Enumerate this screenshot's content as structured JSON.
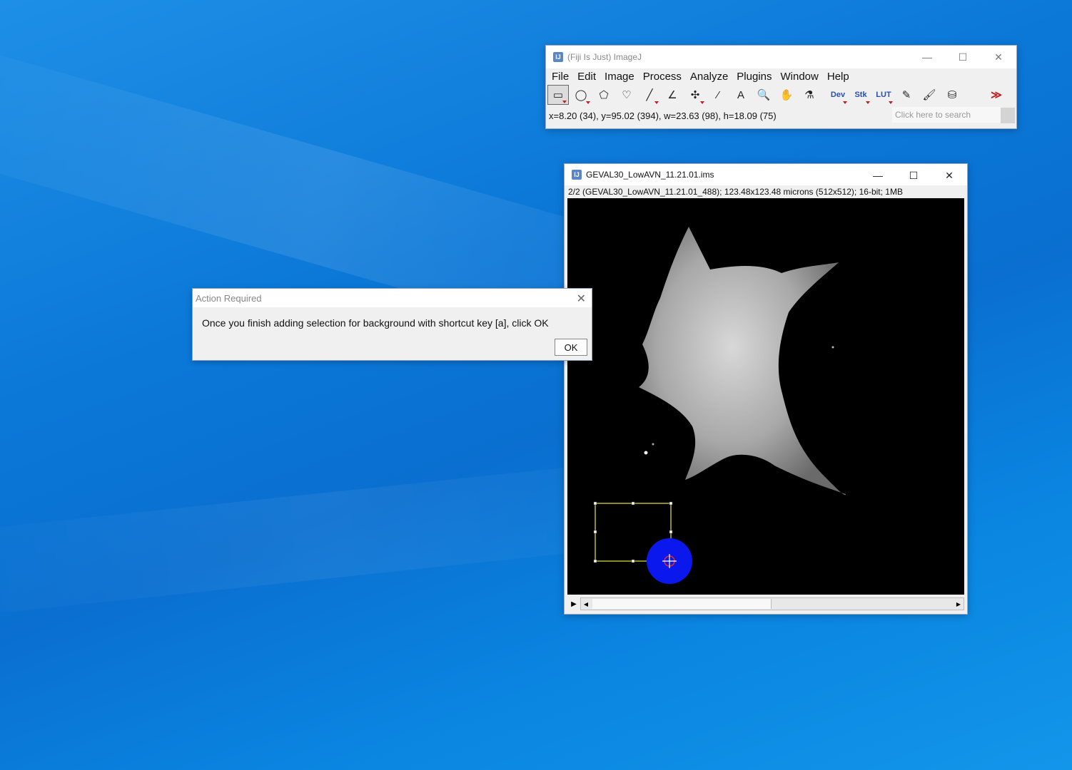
{
  "imagej": {
    "title": "(Fiji Is Just) ImageJ",
    "menus": [
      "File",
      "Edit",
      "Image",
      "Process",
      "Analyze",
      "Plugins",
      "Window",
      "Help"
    ],
    "tools": {
      "rect": "▭",
      "oval": "◯",
      "polygon": "⬠",
      "freehand": "♡",
      "line": "╱",
      "angle": "∠",
      "point": "✣",
      "wand": "⁄",
      "text": "A",
      "zoom": "🔍",
      "hand": "✋",
      "dropper": "⚗",
      "dev": "Dev",
      "stk": "Stk",
      "lut": "LUT",
      "pencil": "✎",
      "brush": "🖌",
      "fill": "⛁",
      "more": "≫"
    },
    "status": "x=8.20 (34), y=95.02 (394), w=23.63 (98), h=18.09 (75)",
    "search_placeholder": "Click here to search",
    "icon_letters": "IJ",
    "win_min": "—",
    "win_max": "☐",
    "win_close": "✕"
  },
  "image_window": {
    "title": "GEVAL30_LowAVN_11.21.01.ims",
    "info": "2/2 (GEVAL30_LowAVN_11.21.01_488); 123.48x123.48 microns (512x512); 16-bit; 1MB",
    "icon_letters": "IJ",
    "win_min": "—",
    "win_max": "☐",
    "win_close": "✕",
    "play": "▶",
    "scroll_left": "◀",
    "scroll_right": "▶"
  },
  "dialog": {
    "title": "Action Required",
    "message": "Once you finish adding selection for background with shortcut key [a], click OK",
    "ok_label": "OK",
    "close": "✕"
  },
  "colors": {
    "desktop": "#0a78d8",
    "selection": "#e8e83a",
    "cursor_circle": "#0a18ee",
    "cursor_cross": "#e03020"
  }
}
